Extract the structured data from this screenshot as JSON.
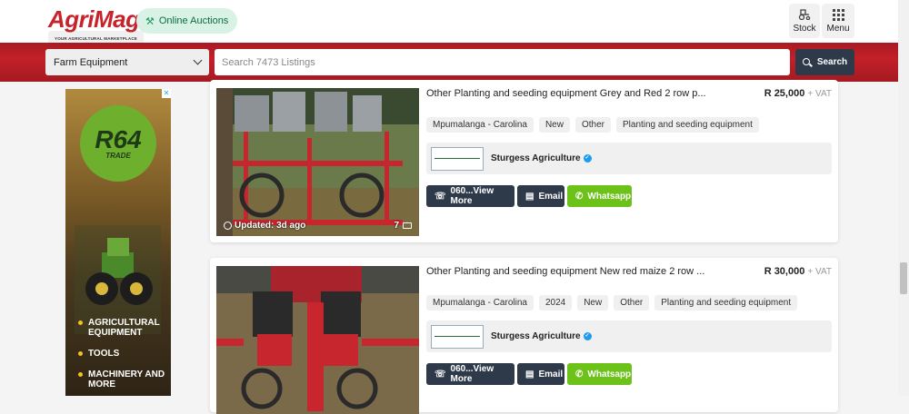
{
  "header": {
    "logo_text": "AgriMag",
    "logo_tagline": "YOUR AGRICULTURAL MARKETPLACE",
    "auctions_label": "Online Auctions",
    "stock_label": "Stock",
    "menu_label": "Menu"
  },
  "search": {
    "category_selected": "Farm Equipment",
    "placeholder": "Search 7473 Listings",
    "button_label": "Search"
  },
  "ad": {
    "brand_big": "R64",
    "brand_small": "TRADE",
    "items": [
      "AGRICULTURAL EQUIPMENT",
      "TOOLS",
      "MACHINERY AND MORE"
    ]
  },
  "listings": [
    {
      "title": "Other Planting and seeding equipment Grey and Red 2 row p...",
      "price": "R 25,000",
      "vat": "+ VAT",
      "updated": "Updated: 3d ago",
      "photo_count": "7",
      "tags": [
        "Mpumalanga - Carolina",
        "New",
        "Other",
        "Planting and seeding equipment"
      ],
      "seller": "Sturgess Agriculture",
      "call_label": "060...View More",
      "email_label": "Email",
      "whatsapp_label": "Whatsapp"
    },
    {
      "title": "Other Planting and seeding equipment New red maize 2 row ...",
      "price": "R 30,000",
      "vat": "+ VAT",
      "tags": [
        "Mpumalanga - Carolina",
        "2024",
        "New",
        "Other",
        "Planting and seeding equipment"
      ],
      "seller": "Sturgess Agriculture",
      "call_label": "060...View More",
      "email_label": "Email",
      "whatsapp_label": "Whatsapp"
    }
  ],
  "colors": {
    "brand_red": "#c32029",
    "dark_button": "#2e3a4a",
    "whatsapp_green": "#6cc218",
    "verified_blue": "#1d9bf0"
  }
}
